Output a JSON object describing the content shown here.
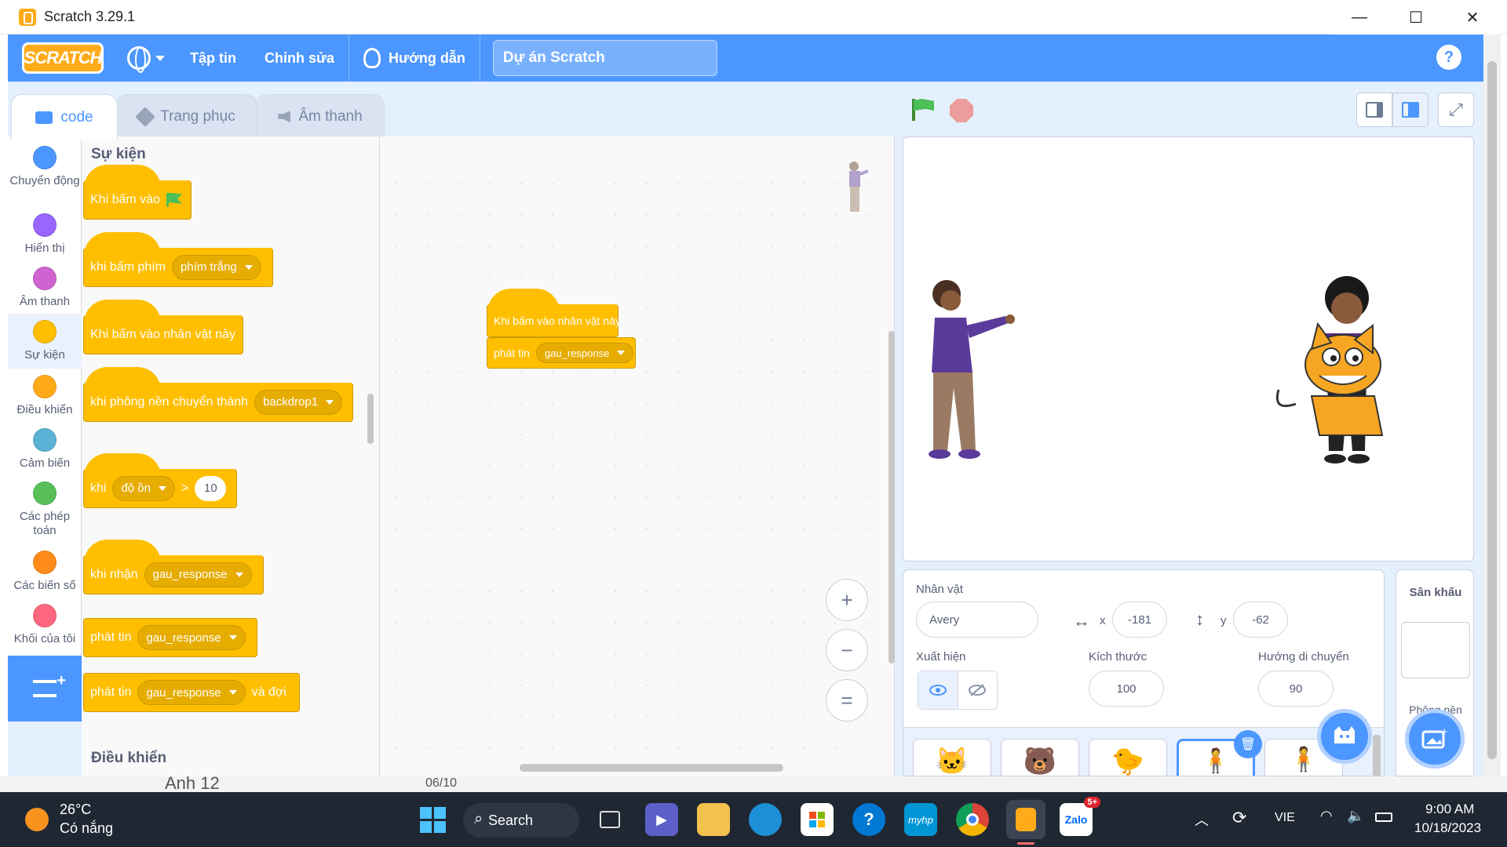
{
  "window": {
    "title": "Scratch 3.29.1",
    "minimize": "—",
    "maximize": "☐",
    "close": "✕"
  },
  "menubar": {
    "logo": "SCRATCH",
    "file": "Tập tin",
    "edit": "Chỉnh sửa",
    "tutorials": "Hướng dẫn",
    "project_title": "Dự án Scratch",
    "help": "?"
  },
  "tabs": {
    "code": "code",
    "costumes": "Trang phục",
    "sounds": "Âm thanh"
  },
  "categories": [
    {
      "label": "Chuyển động",
      "color": "#4c97ff"
    },
    {
      "label": "Hiển thị",
      "color": "#9966ff"
    },
    {
      "label": "Âm thanh",
      "color": "#cf63cf"
    },
    {
      "label": "Sự kiện",
      "color": "#ffbf00"
    },
    {
      "label": "Điều khiển",
      "color": "#ffab19"
    },
    {
      "label": "Cảm biến",
      "color": "#5cb1d6"
    },
    {
      "label": "Các phép toán",
      "color": "#59c059"
    },
    {
      "label": "Các biến số",
      "color": "#ff8c1a"
    },
    {
      "label": "Khối của tôi",
      "color": "#ff6680"
    }
  ],
  "palette": {
    "heading_events": "Sự kiện",
    "heading_control": "Điều khiển",
    "blocks": {
      "when_flag": "Khi bấm vào",
      "when_key": "khi bấm phím",
      "when_key_option": "phím trắng",
      "when_sprite_clicked": "Khi bấm vào nhân vật này",
      "when_backdrop": "khi phông nền chuyển thành",
      "when_backdrop_option": "backdrop1",
      "when_greater": "khi",
      "when_greater_option": "độ ồn",
      "when_greater_op": ">",
      "when_greater_value": "10",
      "when_receive": "khi nhận",
      "when_receive_option": "gau_response",
      "broadcast": "phát tin",
      "broadcast_option": "gau_response",
      "broadcast_wait": "phát tin",
      "broadcast_wait_option": "gau_response",
      "broadcast_wait_suffix": "và đợi"
    }
  },
  "script": {
    "hat": "Khi bấm vào nhân vật này",
    "stmt": "phát tin",
    "stmt_option": "gau_response"
  },
  "zoom": {
    "in": "+",
    "out": "−",
    "reset": "="
  },
  "sprite_info": {
    "label_sprite": "Nhân vật",
    "name": "Avery",
    "x_label": "x",
    "x": "-181",
    "y_label": "y",
    "y": "-62",
    "label_show": "Xuất hiện",
    "label_size": "Kích thước",
    "size": "100",
    "label_direction": "Hướng di chuyển",
    "direction": "90"
  },
  "stage_panel": {
    "title": "Sân khấu",
    "backdrops": "Phông nền"
  },
  "behind_window": {
    "name": "Anh 12",
    "date": "06/10"
  },
  "taskbar": {
    "weather_temp": "26°C",
    "weather_desc": "Có nắng",
    "search": "Search",
    "zalo_badge": "5+",
    "lang": "VIE",
    "time": "9:00 AM",
    "date": "10/18/2023",
    "hp_label": "myhp"
  }
}
